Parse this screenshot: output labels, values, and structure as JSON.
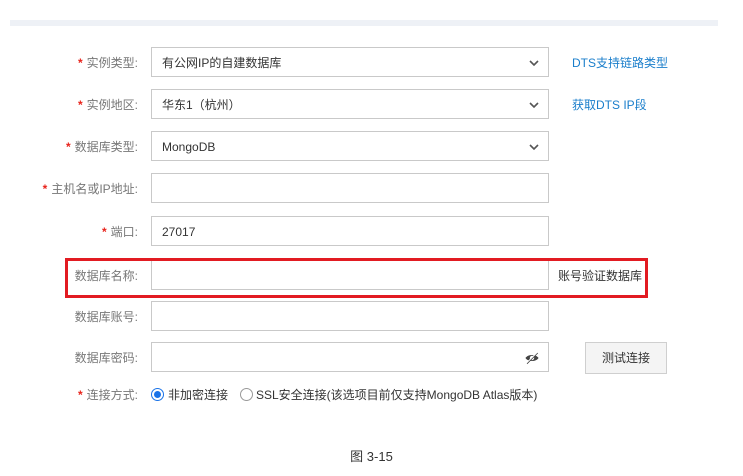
{
  "form": {
    "instance_type": {
      "label": "实例类型:",
      "required": true,
      "value": "有公网IP的自建数据库",
      "link": "DTS支持链路类型"
    },
    "instance_region": {
      "label": "实例地区:",
      "required": true,
      "value": "华东1（杭州）",
      "link": "获取DTS IP段"
    },
    "db_type": {
      "label": "数据库类型:",
      "required": true,
      "value": "MongoDB"
    },
    "host": {
      "label": "主机名或IP地址:",
      "required": true,
      "value": ""
    },
    "port": {
      "label": "端口:",
      "required": true,
      "value": "27017"
    },
    "db_name": {
      "label": "数据库名称:",
      "value": "",
      "hint": "账号验证数据库"
    },
    "db_account": {
      "label": "数据库账号:",
      "value": ""
    },
    "db_password": {
      "label": "数据库密码:",
      "value": ""
    },
    "test_button": "测试连接",
    "connection": {
      "label": "连接方式:",
      "required": true,
      "options": [
        "非加密连接",
        "SSL安全连接(该选项目前仅支持MongoDB Atlas版本)"
      ],
      "selected": "非加密连接"
    }
  },
  "caption": "图 3-15",
  "colors": {
    "required": "#e8231b",
    "link": "#1a7ecb",
    "highlight": "#e21b22",
    "radio": "#1a73e8"
  },
  "icons": {
    "select": "chevron-down-icon",
    "password": "eye-hidden-icon"
  }
}
